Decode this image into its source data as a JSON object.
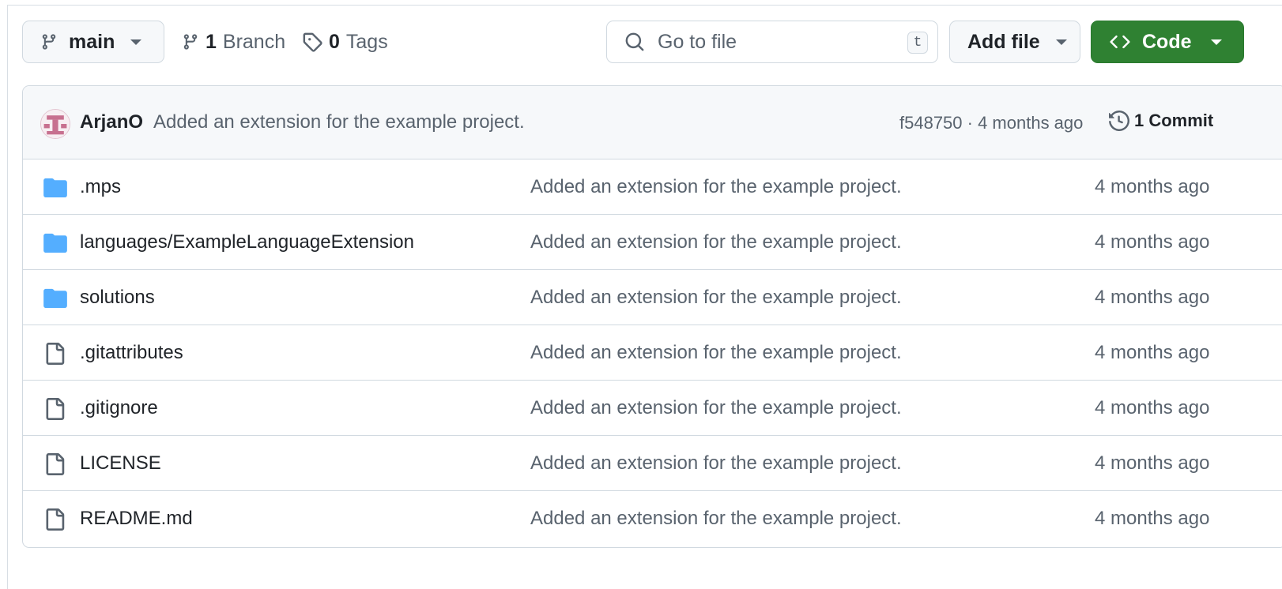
{
  "toolbar": {
    "branch_label": "main",
    "branch_count": "1",
    "branch_count_label": "Branch",
    "tag_count": "0",
    "tag_count_label": "Tags",
    "search_placeholder": "Go to file",
    "search_shortcut": "t",
    "add_file_label": "Add file",
    "code_label": "Code"
  },
  "latest_commit": {
    "author": "ArjanO",
    "message": "Added an extension for the example project.",
    "sha_and_age": "f548750 · 4 months ago",
    "commit_count_label": "1 Commit"
  },
  "files": [
    {
      "type": "folder",
      "name": ".mps",
      "message": "Added an extension for the example project.",
      "age": "4 months ago"
    },
    {
      "type": "folder",
      "name": "languages/ExampleLanguageExtension",
      "message": "Added an extension for the example project.",
      "age": "4 months ago"
    },
    {
      "type": "folder",
      "name": "solutions",
      "message": "Added an extension for the example project.",
      "age": "4 months ago"
    },
    {
      "type": "file",
      "name": ".gitattributes",
      "message": "Added an extension for the example project.",
      "age": "4 months ago"
    },
    {
      "type": "file",
      "name": ".gitignore",
      "message": "Added an extension for the example project.",
      "age": "4 months ago"
    },
    {
      "type": "file",
      "name": "LICENSE",
      "message": "Added an extension for the example project.",
      "age": "4 months ago"
    },
    {
      "type": "file",
      "name": "README.md",
      "message": "Added an extension for the example project.",
      "age": "4 months ago"
    }
  ],
  "icons": {
    "folder": "folder-icon",
    "file": "file-icon"
  },
  "colors": {
    "code_button": "#2f8132",
    "folder": "#54aeff",
    "muted_text": "#59636e"
  }
}
